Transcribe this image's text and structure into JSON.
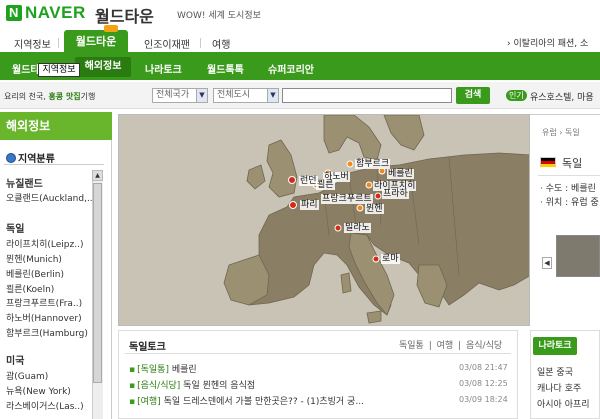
{
  "header": {
    "logo": "NAVER",
    "site_name": "월드타운",
    "slogan": "WOW! 세계 도시정보"
  },
  "nav1": {
    "items": [
      "지역정보",
      "월드타운",
      "인조이재팬",
      "여행"
    ],
    "right_text": "› 이탈리아의 패션, 소"
  },
  "nav2": {
    "items": [
      "월드타운",
      "해외정보",
      "나라토크",
      "월드톡톡",
      "슈퍼코리안"
    ]
  },
  "tooltip": "지역정보",
  "search": {
    "label_prefix": "요리의 천국",
    "label_highlight": "홍콩 맛집",
    "label_suffix": "기행",
    "country_select": "전체국가",
    "city_select": "전체도시",
    "button": "검색",
    "popular_badge": "인기",
    "popular_text": "유스호스텔, 마용"
  },
  "sidebar": {
    "title": "해외정보",
    "subtitle": "지역분류",
    "regions": [
      {
        "name": "뉴질랜드",
        "cities": [
          "오클랜드(Auckland,..)"
        ]
      },
      {
        "name": "독일",
        "cities": [
          "라이프치히(Leipz..)",
          "뮌헨(Munich)",
          "베를린(Berlin)",
          "쾰른(Koeln)",
          "프랑크푸르트(Fra..)",
          "하노버(Hannover)",
          "함부르크(Hamburg)"
        ]
      },
      {
        "name": "미국",
        "cities": [
          "괌(Guam)",
          "뉴욕(New York)",
          "라스베이거스(Las..)"
        ]
      }
    ]
  },
  "map": {
    "cities": [
      {
        "name": "함부르크"
      },
      {
        "name": "하노버"
      },
      {
        "name": "베를린"
      },
      {
        "name": "런던"
      },
      {
        "name": "쾰른"
      },
      {
        "name": "라이프치히"
      },
      {
        "name": "프랑크푸르트"
      },
      {
        "name": "프라하"
      },
      {
        "name": "파리"
      },
      {
        "name": "뮌헨"
      },
      {
        "name": "밀라노"
      },
      {
        "name": "로마"
      }
    ]
  },
  "info": {
    "breadcrumb": "유럽 › 독일",
    "country": "독일",
    "capital_line": "· 수도 : 베를린",
    "location_line": "· 위치 : 유럽 중"
  },
  "talk": {
    "title": "독일토크",
    "tabs": [
      "독일통",
      "|",
      "여행",
      "|",
      "음식/식당"
    ],
    "rows": [
      {
        "tag": "[독일통]",
        "text": "베를린",
        "date": "03/08 21:47"
      },
      {
        "tag": "[음식/식당]",
        "text": "독일 뮌헨의 음식점",
        "date": "03/08 12:25"
      },
      {
        "tag": "[여행]",
        "text": "독일 드레스덴에서 가볼 만한곳은?? - (1)츠빙거 궁...",
        "date": "03/09 18:24"
      }
    ]
  },
  "ntalk": {
    "tab": "나라토크",
    "rows": [
      "일본  중국",
      "캐나다  호주",
      "아시아  아프리"
    ]
  }
}
